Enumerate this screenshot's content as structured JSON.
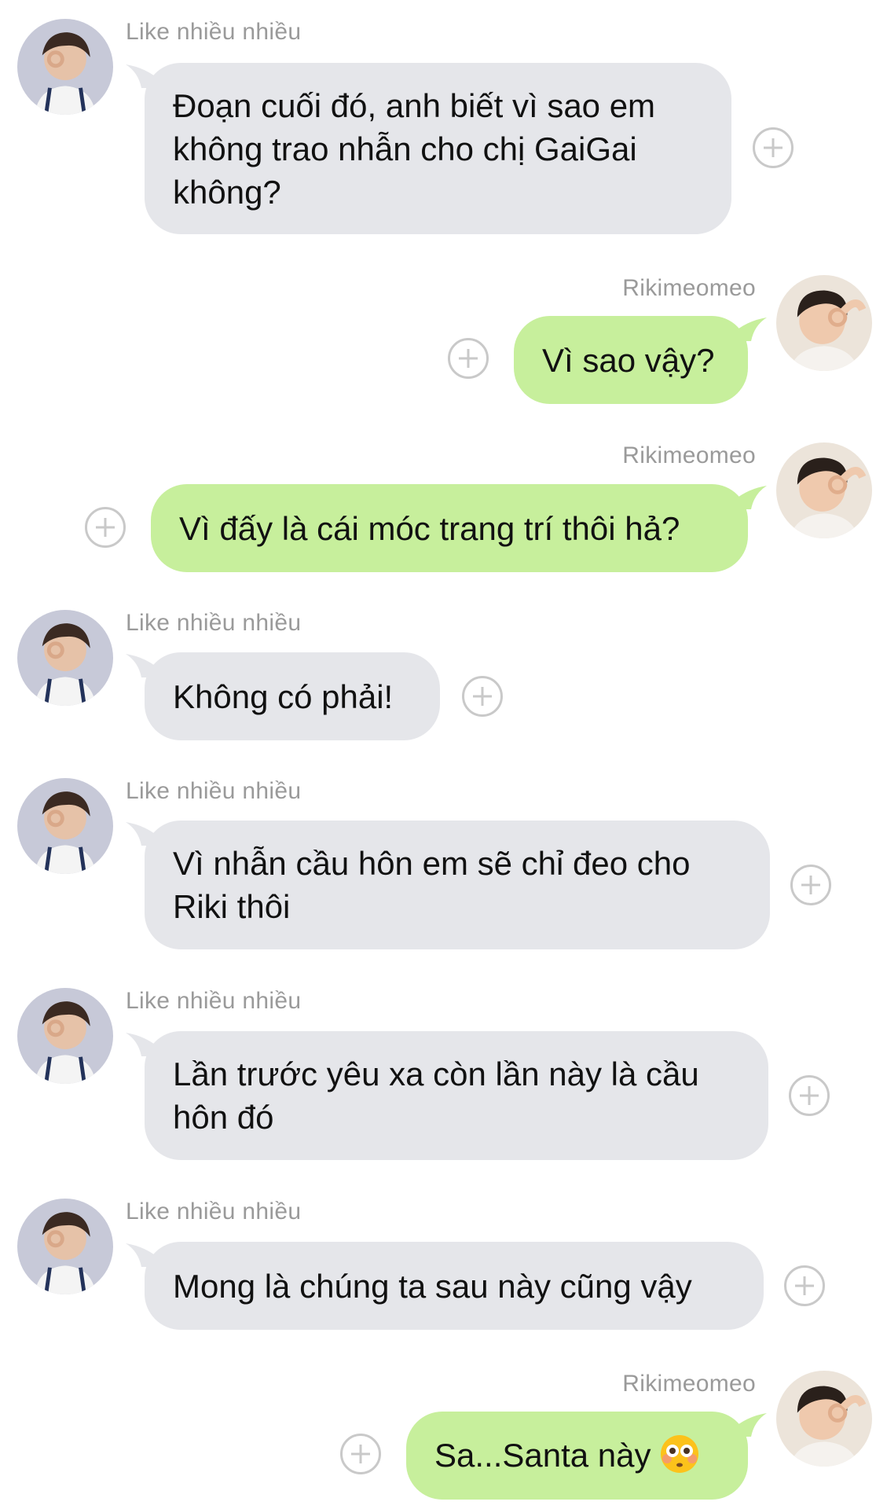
{
  "contacts": {
    "other": {
      "name": "Like nhiều nhiều"
    },
    "me": {
      "name": "Rikimeomeo"
    }
  },
  "messages": [
    {
      "from": "other",
      "text": "Đoạn cuối đó, anh biết vì sao em không trao nhẫn cho chị GaiGai không?"
    },
    {
      "from": "me",
      "text": "Vì sao vậy?"
    },
    {
      "from": "me",
      "text": "Vì đấy là cái móc trang trí thôi hả?"
    },
    {
      "from": "other",
      "text": "Không có phải!"
    },
    {
      "from": "other",
      "text": "Vì nhẫn cầu hôn em sẽ chỉ đeo cho Riki thôi"
    },
    {
      "from": "other",
      "text": "Lần trước yêu xa còn lần này là cầu hôn đó"
    },
    {
      "from": "other",
      "text": "Mong là chúng ta sau này cũng vậy"
    },
    {
      "from": "me",
      "text": "Sa...Santa này",
      "emoji": "flushed-face"
    }
  ],
  "colors": {
    "incoming_bubble": "#e5e6ea",
    "outgoing_bubble": "#c7ef9c",
    "sender_name": "#9a9a9a",
    "react_icon": "#c9c9c9"
  },
  "icons": {
    "react": "add-reaction-icon",
    "avatar_other": "avatar-icon",
    "avatar_me": "avatar-icon"
  }
}
